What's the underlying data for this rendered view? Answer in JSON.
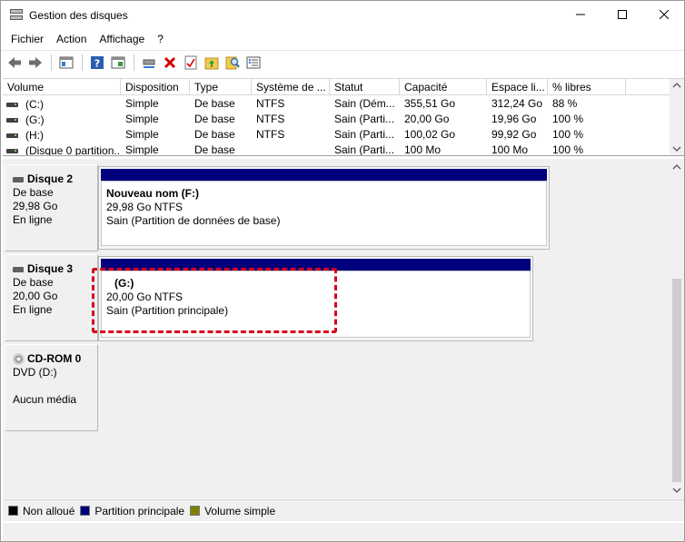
{
  "window": {
    "title": "Gestion des disques",
    "icon": "disk-management-icon"
  },
  "menu": [
    "Fichier",
    "Action",
    "Affichage",
    "?"
  ],
  "toolbar": {
    "icons": [
      "back-arrow-icon",
      "forward-arrow-icon",
      "console-tree-icon",
      "help-icon",
      "properties-icon",
      "connect-icon",
      "delete-icon",
      "checkmark-icon",
      "folder-up-icon",
      "search-icon",
      "details-icon"
    ]
  },
  "volume_list": {
    "columns": [
      "Volume",
      "Disposition",
      "Type",
      "Système de ...",
      "Statut",
      "Capacité",
      "Espace li...",
      "% libres"
    ],
    "rows": [
      [
        "(C:)",
        "Simple",
        "De base",
        "NTFS",
        "Sain (Dém...",
        "355,51 Go",
        "312,24 Go",
        "88 %"
      ],
      [
        "(G:)",
        "Simple",
        "De base",
        "NTFS",
        "Sain (Parti...",
        "20,00 Go",
        "19,96 Go",
        "100 %"
      ],
      [
        "(H:)",
        "Simple",
        "De base",
        "NTFS",
        "Sain (Parti...",
        "100,02 Go",
        "99,92 Go",
        "100 %"
      ],
      [
        "(Disque 0 partition...",
        "Simple",
        "De base",
        "",
        "Sain (Parti...",
        "100 Mo",
        "100 Mo",
        "100 %"
      ]
    ]
  },
  "disks": [
    {
      "name": "Disque 2",
      "type": "De base",
      "size": "29,98 Go",
      "status": "En ligne",
      "partition": {
        "name": "Nouveau nom  (F:)",
        "size": "29,98 Go NTFS",
        "status": "Sain (Partition de données de base)"
      }
    },
    {
      "name": "Disque 3",
      "type": "De base",
      "size": "20,00 Go",
      "status": "En ligne",
      "partition": {
        "name": "(G:)",
        "size": "20,00 Go NTFS",
        "status": "Sain (Partition principale)"
      }
    },
    {
      "name": "CD-ROM 0",
      "type": "DVD (D:)",
      "media": "Aucun média"
    }
  ],
  "legend": [
    {
      "label": "Non alloué",
      "color": "#000000"
    },
    {
      "label": "Partition principale",
      "color": "#00007c"
    },
    {
      "label": "Volume simple",
      "color": "#7f7f00"
    }
  ]
}
